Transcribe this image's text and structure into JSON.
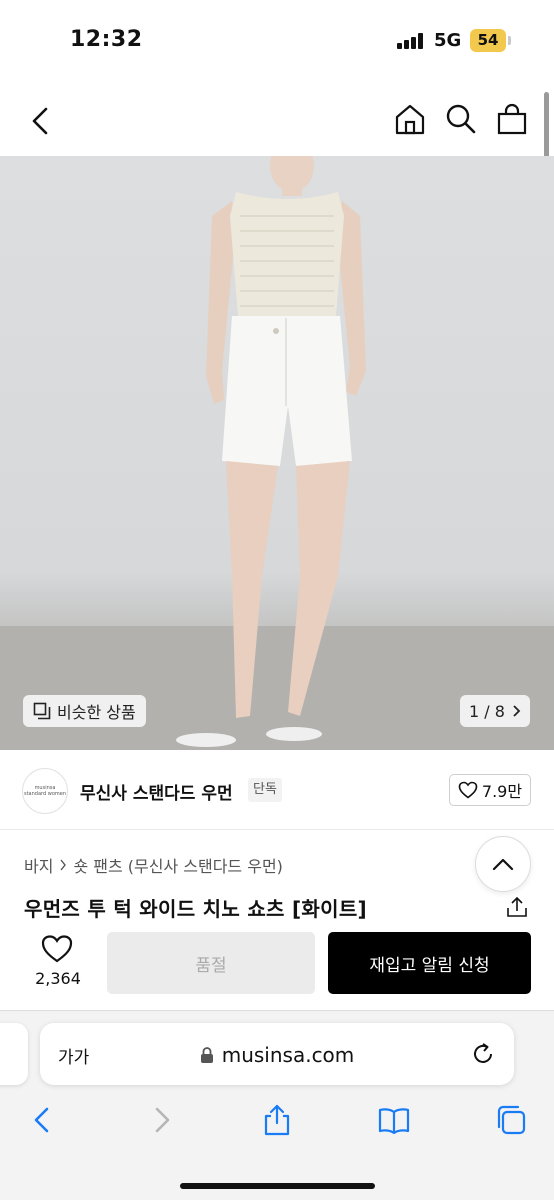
{
  "status_bar": {
    "time": "12:32",
    "network": "5G",
    "battery": "54",
    "battery_color": "#f2c94c"
  },
  "nav": {
    "icons": [
      "back-icon",
      "home-icon",
      "search-icon",
      "shopping-bag-icon"
    ]
  },
  "gallery": {
    "similar_label": "비슷한 상품",
    "page_counter": "1 / 8",
    "background_color": "#d6d8da"
  },
  "brand": {
    "logo_text": "musinsa standard women",
    "name": "무신사 스탠다드 우먼",
    "badge": "단독",
    "likes": "7.9만"
  },
  "product": {
    "breadcrumb": [
      "바지",
      "숏 팬츠 (무신사 스탠다드 우먼)"
    ],
    "title": "우먼즈 투 턱 와이드 치노 쇼츠 [화이트]"
  },
  "purchase": {
    "wish_count": "2,364",
    "soldout_label": "품절",
    "restock_label": "재입고 알림 신청",
    "restock_color": "#000000"
  },
  "browser": {
    "text_size_label": "가가",
    "url": "musinsa.com",
    "toolbar": [
      "back-icon",
      "forward-icon",
      "share-icon",
      "bookmarks-icon",
      "tabs-icon"
    ],
    "accent_color": "#1a7cf5"
  }
}
